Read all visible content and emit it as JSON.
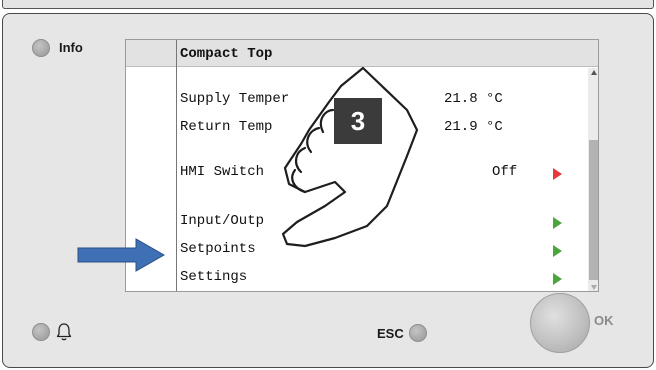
{
  "panel": {
    "info_label": "Info",
    "esc_label": "ESC",
    "ok_label": "OK"
  },
  "screen": {
    "title": "Compact Top",
    "rows": [
      {
        "label": "Supply Temper",
        "value": "21.8 °C",
        "arrow": ""
      },
      {
        "label": "Return Temp",
        "value": "21.9 °C",
        "arrow": ""
      },
      {
        "label": "HMI Switch",
        "value": "Off",
        "arrow": "red"
      },
      {
        "label": "Input/Outp",
        "value": "",
        "arrow": "green"
      },
      {
        "label": "Setpoints",
        "value": "",
        "arrow": "green"
      },
      {
        "label": "Settings",
        "value": "",
        "arrow": "green"
      }
    ]
  },
  "overlay": {
    "step_number": "3"
  },
  "icons": {
    "bell": "bell-icon",
    "pointer": "pointing-hand-icon",
    "callout": "blue-arrow-icon"
  },
  "colors": {
    "arrow_red": "#e8383d",
    "arrow_green": "#4aa63c",
    "callout_blue": "#3f6fb4",
    "badge": "#3b3b3b"
  }
}
